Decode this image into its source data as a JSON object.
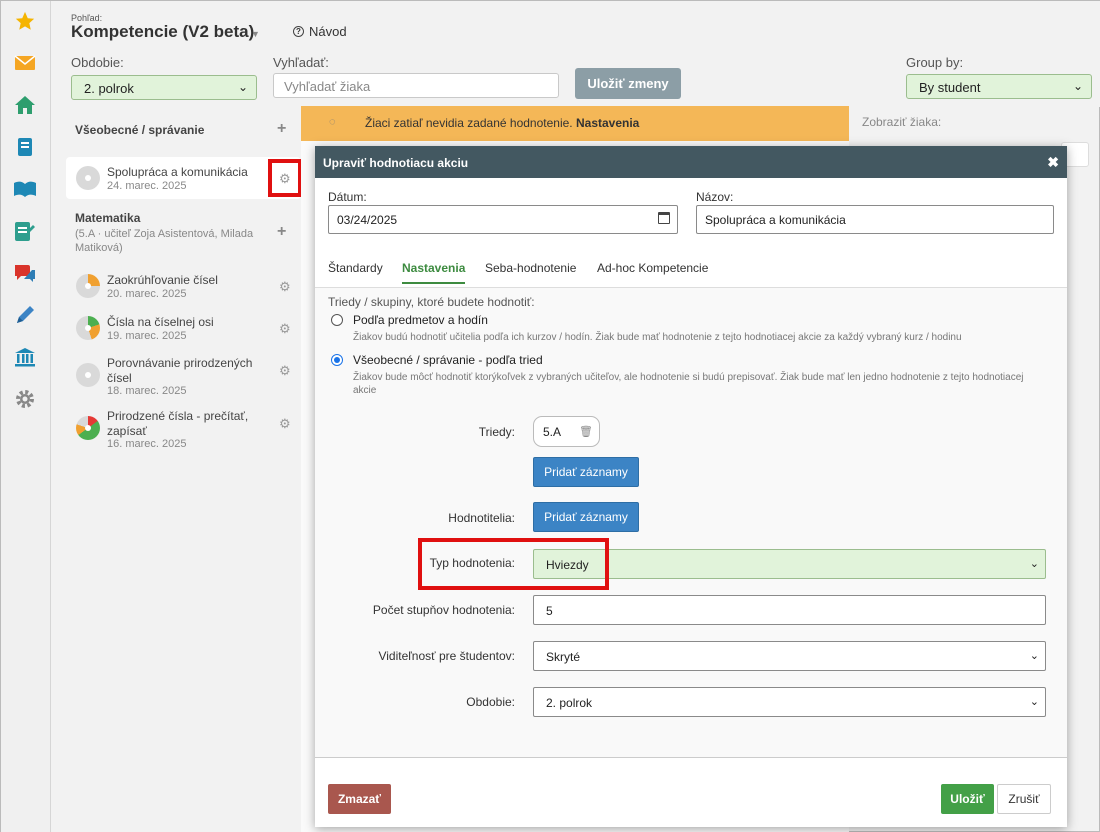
{
  "header": {
    "view_label": "Pohľad:",
    "title": "Kompetencie (V2 beta)",
    "guide_label": "Návod",
    "period_label": "Obdobie:",
    "period_value": "2. polrok",
    "search_label": "Vyhľadať:",
    "search_placeholder": "Vyhľadať žiaka",
    "save_label": "Uložiť zmeny",
    "groupby_label": "Group by:",
    "groupby_value": "By student"
  },
  "sidebar": {
    "groups": [
      {
        "title": "Všeobecné / správanie",
        "subtitle": ""
      },
      {
        "title": "Matematika",
        "subtitle": "(5.A · učiteľ Zoja Asistentová, Milada Matiková)"
      }
    ],
    "items": [
      {
        "title": "Spolupráca a komunikácia",
        "date": "24. marec. 2025"
      },
      {
        "title": "Zaokrúhľovanie čísel",
        "date": "20. marec. 2025"
      },
      {
        "title": "Čísla na číselnej osi",
        "date": "19. marec. 2025"
      },
      {
        "title": "Porovnávanie prirodzených čísel",
        "date": "18. marec. 2025"
      },
      {
        "title": "Prirodzené čísla - prečítať, zapísať",
        "date": "16. marec. 2025"
      }
    ]
  },
  "banner": {
    "text": "Žiaci zatiaľ nevidia zadané hodnotenie.",
    "link": "Nastavenia"
  },
  "show_student_label": "Zobraziť žiaka:",
  "modal": {
    "title": "Upraviť hodnotiacu akciu",
    "date_label": "Dátum:",
    "date_value": "03/24/2025",
    "name_label": "Názov:",
    "name_value": "Spolupráca a komunikácia",
    "tabs": [
      "Štandardy",
      "Nastavenia",
      "Seba-hodnotenie",
      "Ad-hoc Kompetencie"
    ],
    "intro": "Triedy / skupiny, ktoré budete hodnotiť:",
    "option1_title": "Podľa predmetov a hodín",
    "option1_desc": "Žiakov budú hodnotiť učitelia podľa ich kurzov / hodín. Žiak bude mať hodnotenie z tejto hodnotiacej akcie za každý vybraný kurz / hodinu",
    "option2_title": "Všeobecné / správanie - podľa tried",
    "option2_desc": "Žiakov bude môcť hodnotiť ktorýkoľvek z vybraných učiteľov, ale hodnotenie si budú prepisovať. Žiak bude mať len jedno hodnotenie z tejto hodnotiacej akcie",
    "classes_label": "Triedy:",
    "class_tag": "5.A",
    "add_records_label": "Pridať záznamy",
    "raters_label": "Hodnotitelia:",
    "type_label": "Typ hodnotenia:",
    "type_value": "Hviezdy",
    "levels_label": "Počet stupňov hodnotenia:",
    "levels_value": "5",
    "visibility_label": "Viditeľnosť pre študentov:",
    "visibility_value": "Skryté",
    "period_label": "Obdobie:",
    "period_value": "2. polrok",
    "delete_label": "Zmazať",
    "save_label": "Uložiť",
    "cancel_label": "Zrušiť"
  },
  "colors": {
    "accent_green": "#3d8b40",
    "modal_header": "#435861",
    "banner": "#f4b757",
    "primary_blue": "#3c84c5",
    "danger": "#a9574e",
    "highlight": "#e01010"
  }
}
